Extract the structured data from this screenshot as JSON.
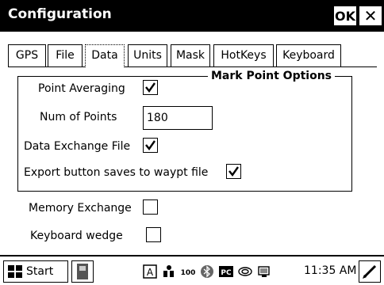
{
  "window": {
    "title": "Configuration",
    "ok_label": "OK",
    "close_label": "✕"
  },
  "tabs": [
    {
      "label": "GPS",
      "active": false
    },
    {
      "label": "File",
      "active": false
    },
    {
      "label": "Data",
      "active": true
    },
    {
      "label": "Units",
      "active": false
    },
    {
      "label": "Mask",
      "active": false
    },
    {
      "label": "HotKeys",
      "active": false
    },
    {
      "label": "Keyboard",
      "active": false
    }
  ],
  "mark_point_options": {
    "title": "Mark Point Options",
    "point_averaging": {
      "label": "Point Averaging",
      "checked": true
    },
    "num_points": {
      "label": "Num of Points",
      "value": "180"
    },
    "data_exchange_file": {
      "label": "Data Exchange File",
      "checked": true
    },
    "export_button": {
      "label": "Export button saves to waypt file",
      "checked": true
    }
  },
  "memory_exchange": {
    "label": "Memory Exchange",
    "checked": false
  },
  "keyboard_wedge": {
    "label": "Keyboard wedge",
    "checked": false
  },
  "taskbar": {
    "start_label": "Start",
    "clock": "11:35 AM",
    "tray_icons": [
      "gps-a-icon",
      "connectivity-icon",
      "100-icon",
      "bluetooth-icon",
      "pc-icon",
      "wireless-icon",
      "battery-icon"
    ]
  }
}
